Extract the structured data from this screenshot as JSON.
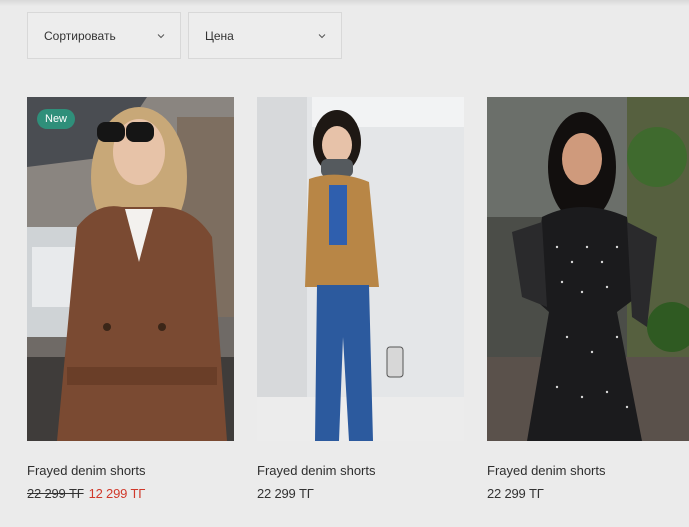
{
  "filters": {
    "sort_label": "Сортировать",
    "price_label": "Цена"
  },
  "products": [
    {
      "badge": "New",
      "title": "Frayed denim shorts",
      "old_price": "22 299 ТГ",
      "sale_price": "12 299 ТГ"
    },
    {
      "title": "Frayed denim shorts",
      "price": "22 299 ТГ"
    },
    {
      "title": "Frayed denim shorts",
      "price": "22 299 ТГ"
    }
  ],
  "colors": {
    "badge_bg": "#2f8f7a",
    "sale_price": "#d0392b",
    "background": "#ebebeb"
  },
  "icons": [
    "chevron-down-icon"
  ]
}
